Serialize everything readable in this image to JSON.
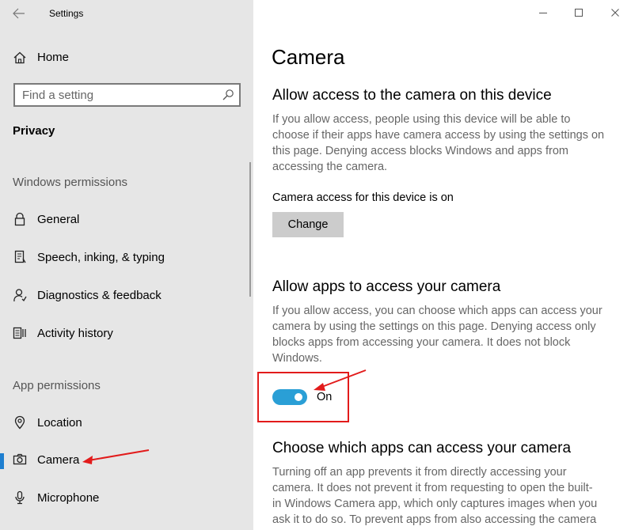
{
  "window": {
    "app_title": "Settings"
  },
  "sidebar": {
    "home_label": "Home",
    "search_placeholder": "Find a setting",
    "section": "Privacy",
    "group_windows": "Windows permissions",
    "group_app": "App permissions",
    "items": [
      {
        "label": "General",
        "icon": "lock-icon",
        "active": false
      },
      {
        "label": "Speech, inking, & typing",
        "icon": "speech-document-icon",
        "active": false
      },
      {
        "label": "Diagnostics & feedback",
        "icon": "diagnostics-person-icon",
        "active": false
      },
      {
        "label": "Activity history",
        "icon": "activity-history-icon",
        "active": false
      },
      {
        "label": "Location",
        "icon": "location-pin-icon",
        "active": false
      },
      {
        "label": "Camera",
        "icon": "camera-icon",
        "active": true
      },
      {
        "label": "Microphone",
        "icon": "microphone-icon",
        "active": false
      }
    ]
  },
  "main": {
    "page_title": "Camera",
    "device_section": {
      "heading": "Allow access to the camera on this device",
      "lines": [
        "If you allow access, people using this device will be able to",
        "choose if their apps have camera access by using the settings on",
        "this page. Denying access blocks Windows and apps from",
        "accessing the camera."
      ],
      "status": "Camera access for this device is on",
      "button_label": "Change"
    },
    "apps_section": {
      "heading": "Allow apps to access your camera",
      "lines": [
        "If you allow access, you can choose which apps can access your",
        "camera by using the settings on this page. Denying access only",
        "blocks apps from accessing your camera. It does not block",
        "Windows."
      ],
      "toggle_on": true,
      "toggle_label": "On"
    },
    "choose_section": {
      "heading": "Choose which apps can access your camera",
      "lines": [
        "Turning off an app prevents it from directly accessing your",
        "camera. It does not prevent it from requesting to open the built-",
        "in Windows Camera app, which only captures images when you",
        "ask it to do so. To prevent apps from also accessing the camera"
      ]
    }
  },
  "colors": {
    "accent": "#2a9fd6",
    "selection": "#1e7fd0",
    "annotation": "#e21b1b",
    "sidebar_bg": "#e6e6e6"
  }
}
